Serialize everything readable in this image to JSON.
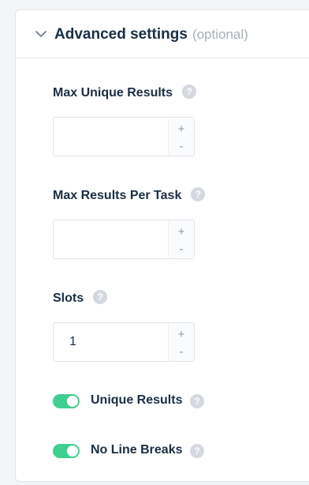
{
  "section": {
    "title": "Advanced settings",
    "optional": "(optional)",
    "expanded": true
  },
  "fields": [
    {
      "label": "Max Unique Results",
      "value": "",
      "help": "?"
    },
    {
      "label": "Max Results Per Task",
      "value": "",
      "help": "?"
    },
    {
      "label": "Slots",
      "value": "1",
      "help": "?"
    }
  ],
  "stepper": {
    "plus": "+",
    "minus": "-"
  },
  "toggles": [
    {
      "label": "Unique Results",
      "on": true,
      "help": "?"
    },
    {
      "label": "No Line Breaks",
      "on": true,
      "help": "?"
    }
  ],
  "colors": {
    "toggle_on": "#3fcf8e",
    "text": "#1a2e44",
    "muted": "#a7b0bb"
  }
}
